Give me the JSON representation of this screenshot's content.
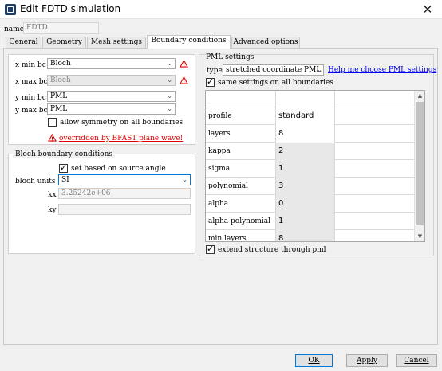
{
  "window": {
    "title": "Edit FDTD simulation",
    "close_glyph": "✕"
  },
  "name": {
    "label": "name",
    "value": "FDTD"
  },
  "tabs": [
    {
      "label": "General"
    },
    {
      "label": "Geometry"
    },
    {
      "label": "Mesh settings"
    },
    {
      "label": "Boundary conditions"
    },
    {
      "label": "Advanced options"
    }
  ],
  "active_tab": "Boundary conditions",
  "boundaries": {
    "x_min": {
      "label": "x min bc",
      "value": "Bloch",
      "warning": true
    },
    "x_max": {
      "label": "x max bc",
      "value": "Bloch",
      "disabled": true,
      "warning": true
    },
    "y_min": {
      "label": "y min bc",
      "value": "PML"
    },
    "y_max": {
      "label": "y max bc",
      "value": "PML"
    },
    "allow_symmetry": {
      "label": "allow symmetry on all boundaries",
      "checked": false
    },
    "override_note": "overridden by BFAST plane wave!"
  },
  "bloch": {
    "title": "Bloch boundary conditions",
    "set_based": {
      "label": "set based on source angle",
      "checked": true
    },
    "units_label": "bloch units",
    "units_value": "SI",
    "kx_label": "kx",
    "kx_value": "3.25242e+06",
    "ky_label": "ky",
    "ky_value": ""
  },
  "pml": {
    "title": "PML settings",
    "type_label": "type",
    "type_value": "stretched coordinate PML",
    "help_link": "Help me choose PML settings",
    "same_settings": {
      "label": "same settings on all boundaries",
      "checked": true
    },
    "rows": [
      {
        "label": "profile",
        "value": "standard"
      },
      {
        "label": "layers",
        "value": "8"
      },
      {
        "label": "kappa",
        "value": "2"
      },
      {
        "label": "sigma",
        "value": "1"
      },
      {
        "label": "polynomial",
        "value": "3"
      },
      {
        "label": "alpha",
        "value": "0"
      },
      {
        "label": "alpha polynomial",
        "value": "1"
      },
      {
        "label": "min layers",
        "value": "8"
      }
    ],
    "extend": {
      "label": "extend structure through pml",
      "checked": true
    }
  },
  "buttons": {
    "ok": "OK",
    "apply": "Apply",
    "cancel": "Cancel"
  },
  "colors": {
    "warning": "#e00000",
    "link": "#0000ee",
    "focus": "#0078d7"
  }
}
